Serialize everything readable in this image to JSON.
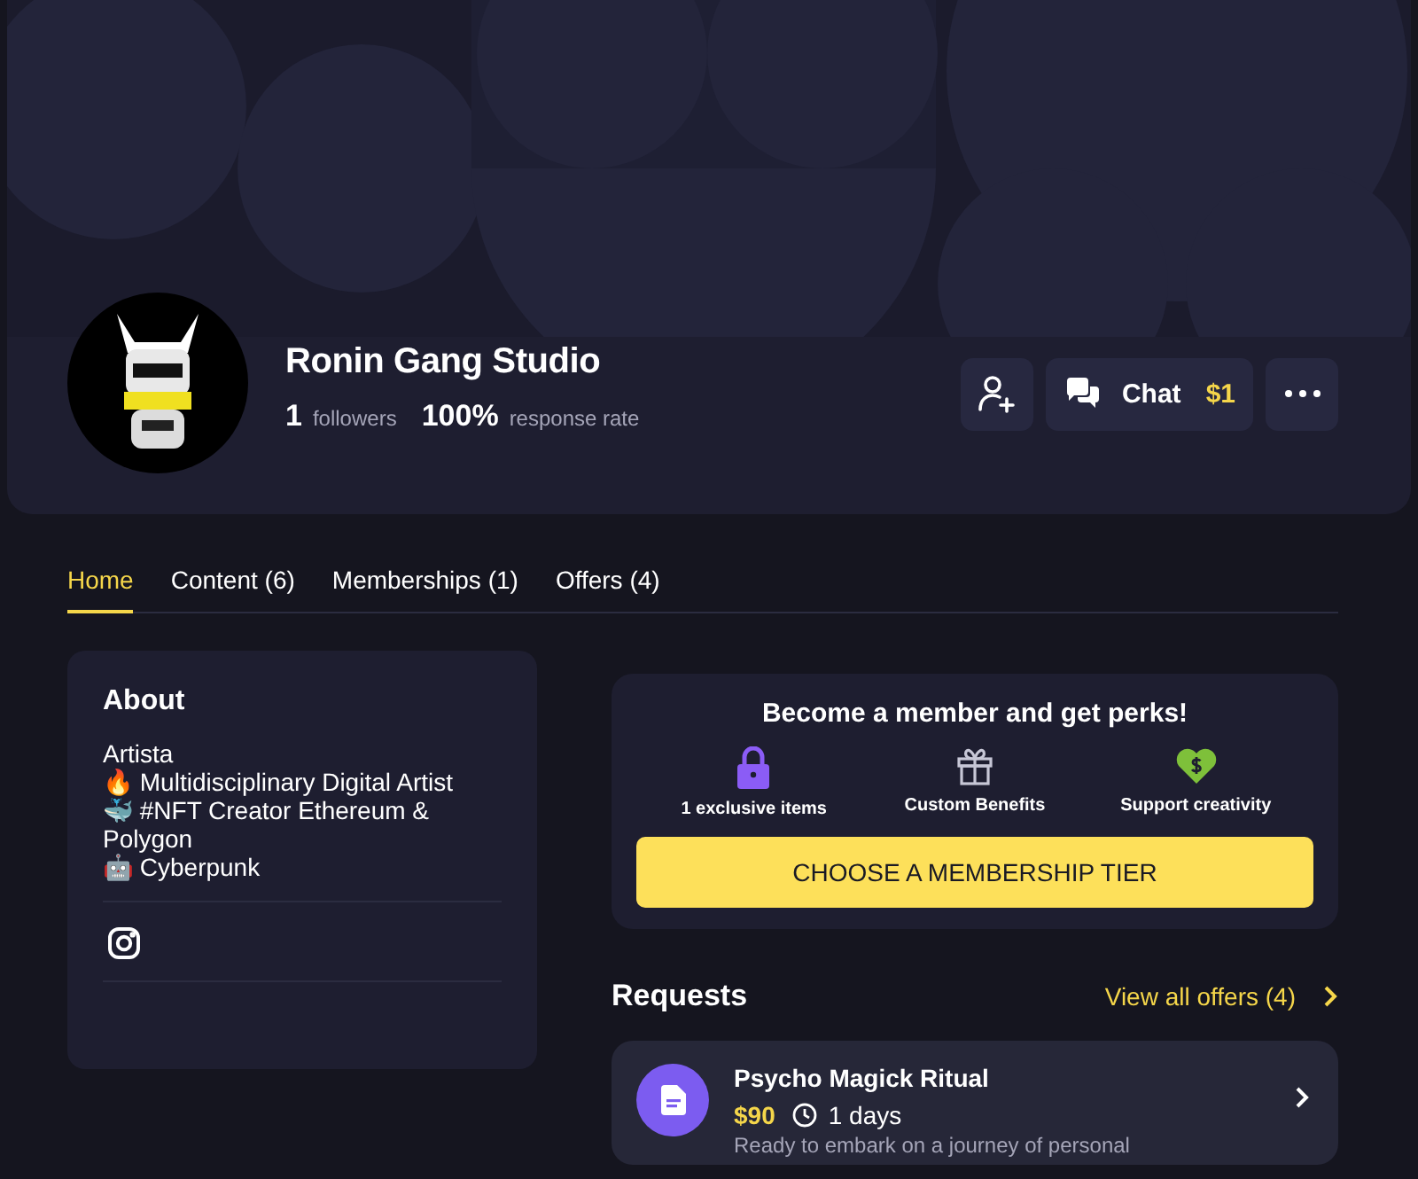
{
  "profile": {
    "name": "Ronin Gang Studio",
    "followers_count": "1",
    "followers_label": "followers",
    "response_value": "100%",
    "response_label": "response rate",
    "chat_label": "Chat",
    "chat_price": "$1"
  },
  "tabs": [
    {
      "label": "Home",
      "selected": true
    },
    {
      "label": "Content (6)",
      "selected": false
    },
    {
      "label": "Memberships (1)",
      "selected": false
    },
    {
      "label": "Offers (4)",
      "selected": false
    }
  ],
  "about": {
    "title": "About",
    "lines": [
      "Artista",
      "🔥 Multidisciplinary Digital Artist",
      "🐳 #NFT Creator Ethereum & Polygon",
      "🤖 Cyberpunk"
    ]
  },
  "membership": {
    "title": "Become a member and get perks!",
    "perks": [
      {
        "kind": "lock",
        "label": "1 exclusive items"
      },
      {
        "kind": "gift",
        "label": "Custom Benefits"
      },
      {
        "kind": "heart",
        "label": "Support creativity"
      }
    ],
    "button": "CHOOSE A MEMBERSHIP TIER"
  },
  "requests": {
    "title": "Requests",
    "view_all": "View all offers (4)",
    "items": [
      {
        "title": "Psycho Magick Ritual",
        "price": "$90",
        "duration": "1 days",
        "description": "Ready to embark on a journey of personal"
      }
    ]
  }
}
